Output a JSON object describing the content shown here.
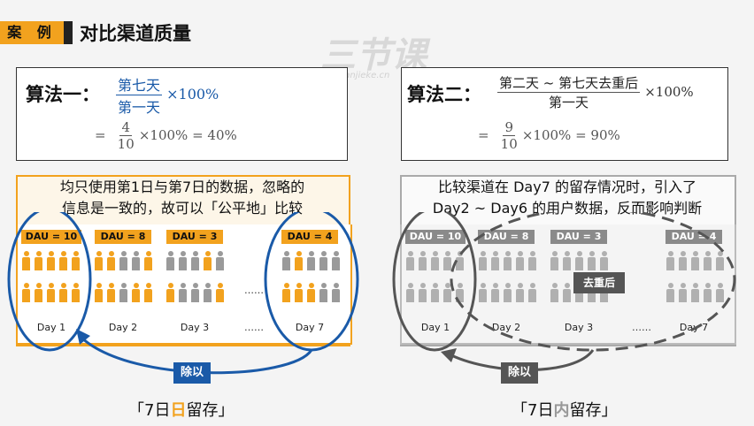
{
  "header": {
    "tag": "案 例",
    "title": "对比渠道质量"
  },
  "watermark": {
    "main": "三节课",
    "sub": "sanjieke.cn"
  },
  "formula1": {
    "label": "算法一：",
    "num": "第七天",
    "den": "第一天",
    "suffix": "×100%",
    "eq_prefix": "=",
    "eq_num": "4",
    "eq_den": "10",
    "eq_suffix": "×100% = 40%"
  },
  "formula2": {
    "label": "算法二：",
    "num": "第二天 ~ 第七天去重后",
    "den": "第一天",
    "suffix": "×100%",
    "eq_prefix": "=",
    "eq_num": "9",
    "eq_den": "10",
    "eq_suffix": "×100% = 90%"
  },
  "left_panel": {
    "desc_line1": "均只使用第1日与第7日的数据，忽略的",
    "desc_line2": "信息是一致的，故可以「公平地」比较",
    "groups": [
      {
        "dau": "DAU = 10",
        "day": "Day 1"
      },
      {
        "dau": "DAU = 8",
        "day": "Day 2"
      },
      {
        "dau": "DAU = 3",
        "day": "Day 3"
      },
      {
        "dau": "DAU = 4",
        "day": "Day 7"
      }
    ],
    "ellipsis": "……",
    "divide_label": "除以",
    "footer_pre": "「7日",
    "footer_hl": "日",
    "footer_post": "留存」"
  },
  "right_panel": {
    "desc_line1": "比较渠道在 Day7 的留存情况时，引入了",
    "desc_line2": "Day2 ~ Day6 的用户数据，反而影响判断",
    "groups": [
      {
        "dau": "DAU = 10",
        "day": "Day 1"
      },
      {
        "dau": "DAU = 8",
        "day": "Day 2"
      },
      {
        "dau": "DAU = 3",
        "day": "Day 3"
      },
      {
        "dau": "DAU = 4",
        "day": "Day 7"
      }
    ],
    "ellipsis": "……",
    "dedup_label": "去重后",
    "divide_label": "除以",
    "footer_pre": "「7日",
    "footer_hl": "内",
    "footer_post": "留存」"
  },
  "colors": {
    "accent": "#f2a21e",
    "blue": "#1a5aa8",
    "gray": "#8a8a8a",
    "dark": "#555555"
  }
}
